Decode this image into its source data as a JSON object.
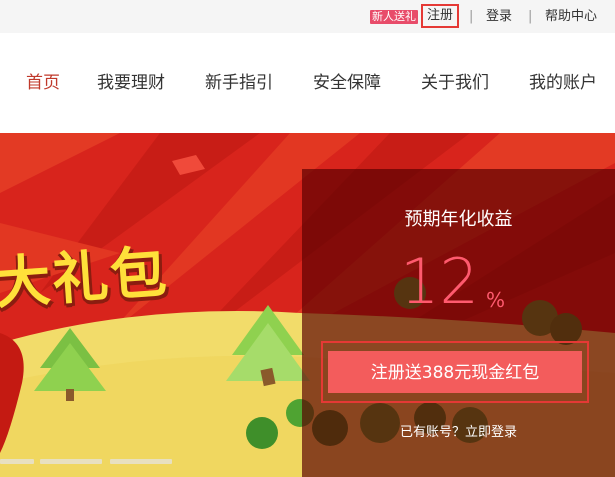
{
  "topbar": {
    "promo_badge": "新人送礼",
    "register": "注册",
    "separator": "|",
    "login": "登录",
    "help": "帮助中心"
  },
  "nav": {
    "items": [
      {
        "label": "首页",
        "active": true
      },
      {
        "label": "我要理财"
      },
      {
        "label": "新手指引"
      },
      {
        "label": "安全保障"
      },
      {
        "label": "关于我们"
      },
      {
        "label": "我的账户"
      }
    ]
  },
  "banner": {
    "headline": "大礼包",
    "yield_label": "预期年化收益",
    "yield_value": "12",
    "yield_unit": "%",
    "cta_label": "注册送388元现金红包",
    "have_account": "已有账号？",
    "login_now": "立即登录"
  },
  "colors": {
    "accent_red": "#c0392b",
    "badge_pink": "#e84c6a",
    "highlight_border": "#e53935",
    "yield_pink": "#ff5a6e",
    "cta_bg": "#f35c5c",
    "banner_red": "#d8241c",
    "hill_yellow": "#f2dc6a"
  }
}
